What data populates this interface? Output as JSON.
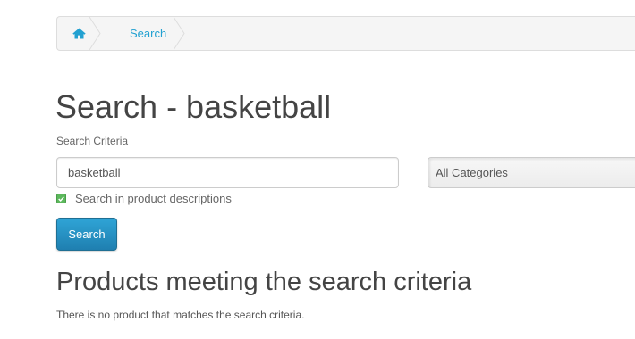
{
  "breadcrumb": {
    "home_icon": "home-icon",
    "items": [
      "Search"
    ]
  },
  "heading": "Search - basketball",
  "criteria_label": "Search Criteria",
  "search": {
    "value": "basketball"
  },
  "category_select": {
    "selected": "All Categories"
  },
  "description_option": {
    "label": "Search in product descriptions",
    "checked": true
  },
  "search_button_label": "Search",
  "results": {
    "title": "Products meeting the search criteria",
    "empty_message": "There is no product that matches the search criteria."
  },
  "colors": {
    "link": "#23a1d1",
    "button": "#2a96c8",
    "checkbox": "#5cb85c",
    "heading": "#444444"
  }
}
